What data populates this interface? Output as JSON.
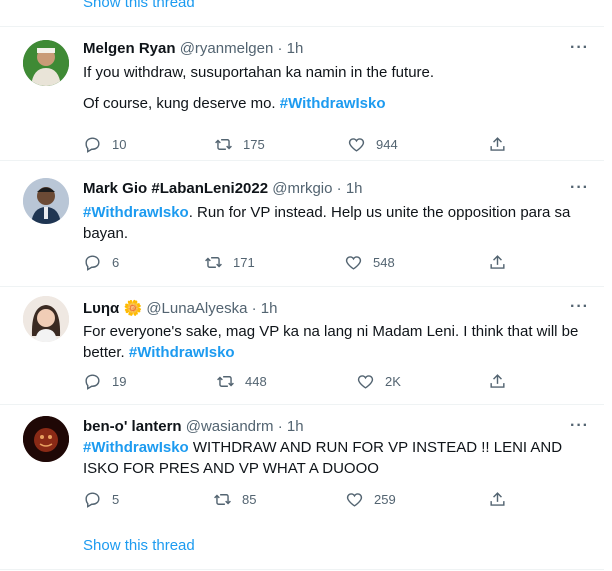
{
  "top_show_thread": "Show this thread",
  "tweets": [
    {
      "name": "Melgen Ryan",
      "handle": "@ryanmelgen",
      "time": "· 1h",
      "lines": [
        "If you withdraw, susuportahan ka namin in the future."
      ],
      "line2_prefix": "Of course, kung deserve mo. ",
      "hashtag": "#WithdrawIsko",
      "replies": "10",
      "retweets": "175",
      "likes": "944"
    },
    {
      "name": "Mark Gio #LabanLeni2022",
      "handle": "@mrkgio",
      "time": "· 1h",
      "hashtag": "#WithdrawIsko",
      "text_after": ". Run for VP instead. Help us unite the opposition para sa bayan.",
      "replies": "6",
      "retweets": "171",
      "likes": "548"
    },
    {
      "name": "Lυηα",
      "emoji": "🌼",
      "handle": "@LunaAlyeska",
      "time": "· 1h",
      "text_before": "For everyone's sake, mag VP ka na lang ni Madam Leni. I think that will be better. ",
      "hashtag": "#WithdrawIsko",
      "replies": "19",
      "retweets": "448",
      "likes": "2K"
    },
    {
      "name": "ben-o' lantern",
      "handle": "@wasiandrm",
      "time": "· 1h",
      "hashtag": "#WithdrawIsko",
      "text_after": " WITHDRAW AND RUN FOR VP INSTEAD !! LENI AND ISKO FOR PRES AND VP WHAT A DUOOO",
      "replies": "5",
      "retweets": "85",
      "likes": "259"
    }
  ],
  "bottom_show_thread": "Show this thread",
  "more_label": "···",
  "colors": {
    "link": "#1d9bf0",
    "muted": "#536471",
    "text": "#0f1419",
    "divider": "#eff3f4"
  }
}
